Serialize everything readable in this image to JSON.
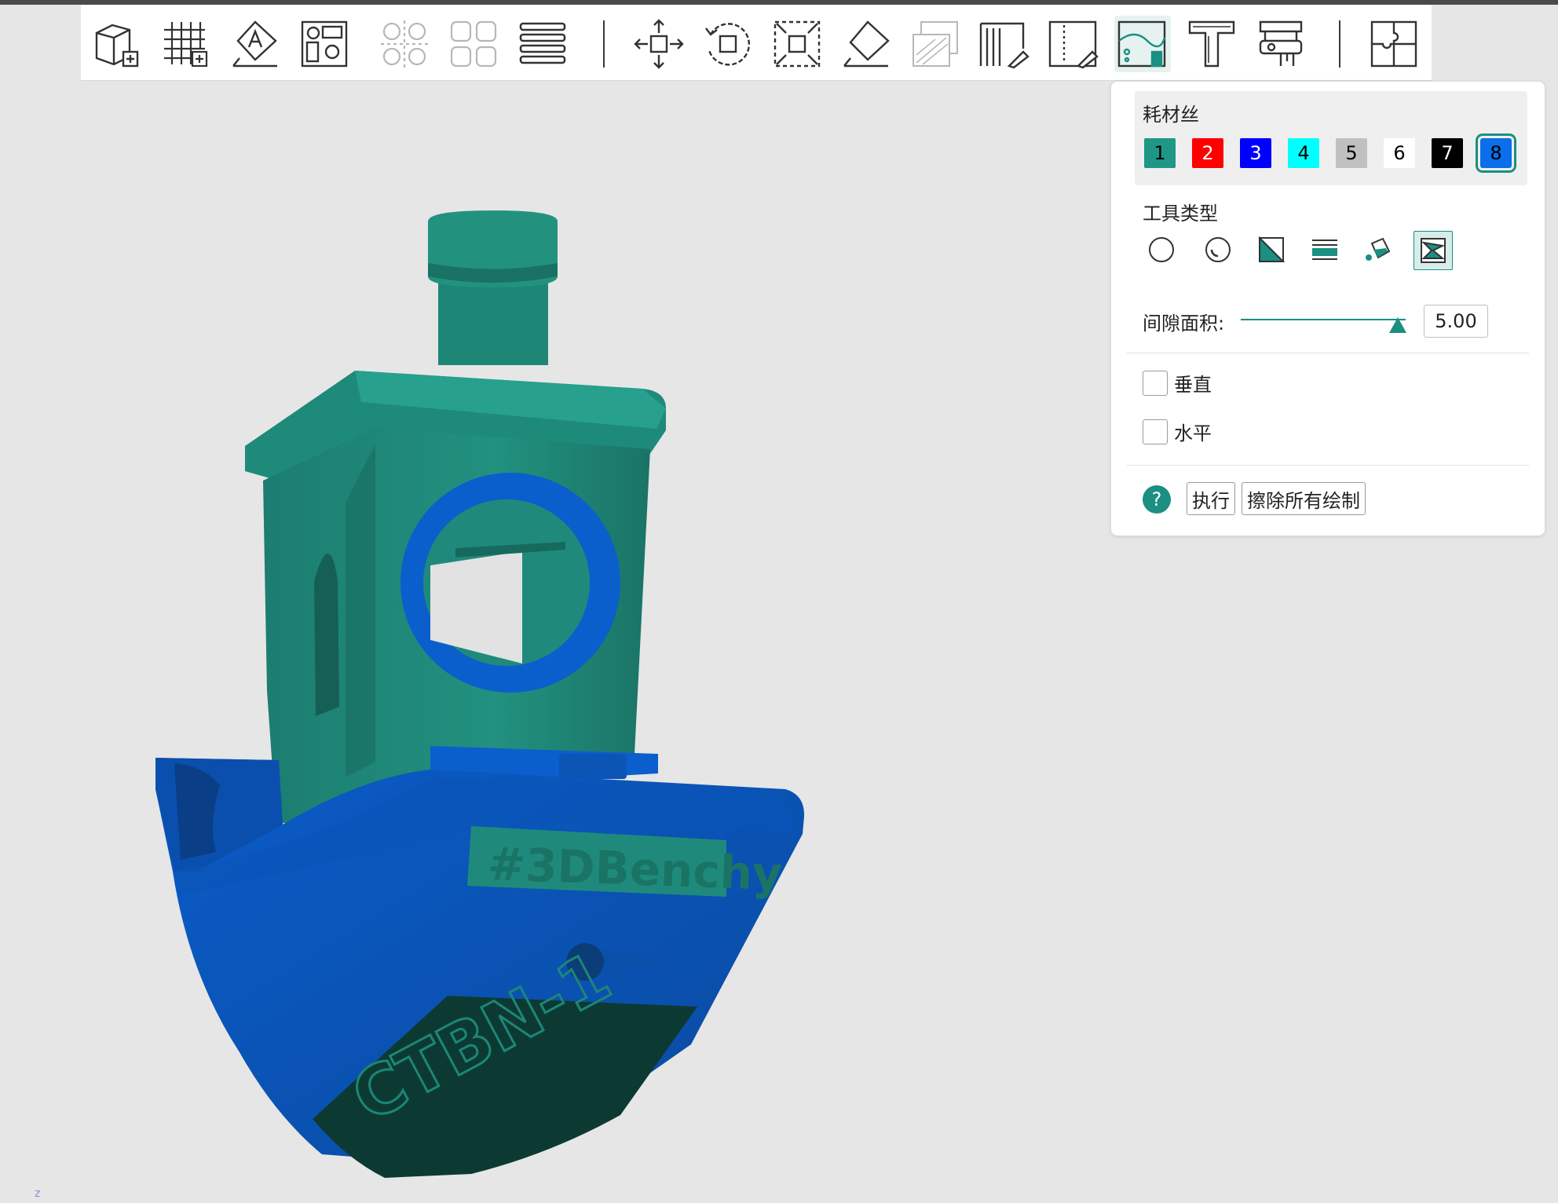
{
  "toolbar": {
    "tools": [
      {
        "name": "add-object",
        "icon": "cube-plus-icon",
        "state": "enabled"
      },
      {
        "name": "add-plate",
        "icon": "grid-plus-icon",
        "state": "enabled"
      },
      {
        "name": "auto-orient",
        "icon": "orient-a-icon",
        "state": "enabled"
      },
      {
        "name": "arrange",
        "icon": "arrange-icon",
        "state": "enabled"
      },
      {
        "name": "split-objects",
        "icon": "split-objects-icon",
        "state": "disabled"
      },
      {
        "name": "split-parts",
        "icon": "split-parts-icon",
        "state": "disabled"
      },
      {
        "name": "variable-layer-height",
        "icon": "layers-icon",
        "state": "enabled"
      },
      {
        "name": "move",
        "icon": "move-icon",
        "state": "enabled"
      },
      {
        "name": "rotate",
        "icon": "rotate-icon",
        "state": "enabled"
      },
      {
        "name": "scale",
        "icon": "scale-icon",
        "state": "enabled"
      },
      {
        "name": "lay-on-face",
        "icon": "lay-on-face-icon",
        "state": "enabled"
      },
      {
        "name": "cut",
        "icon": "cut-icon",
        "state": "disabled"
      },
      {
        "name": "support-paint",
        "icon": "support-paint-icon",
        "state": "enabled"
      },
      {
        "name": "seam-paint",
        "icon": "seam-paint-icon",
        "state": "enabled"
      },
      {
        "name": "color-paint",
        "icon": "color-paint-icon",
        "state": "active"
      },
      {
        "name": "text",
        "icon": "text-icon",
        "state": "enabled"
      },
      {
        "name": "measure",
        "icon": "measure-icon",
        "state": "enabled"
      },
      {
        "name": "assembly",
        "icon": "puzzle-icon",
        "state": "enabled"
      }
    ]
  },
  "panel": {
    "filament_title": "耗材丝",
    "filaments": [
      {
        "label": "1",
        "color": "#1f9787",
        "text": "#000000"
      },
      {
        "label": "2",
        "color": "#ff0000",
        "text": "#ffffff"
      },
      {
        "label": "3",
        "color": "#0000ff",
        "text": "#ffffff"
      },
      {
        "label": "4",
        "color": "#00ffff",
        "text": "#000000"
      },
      {
        "label": "5",
        "color": "#c0c0c0",
        "text": "#000000"
      },
      {
        "label": "6",
        "color": "#ffffff",
        "text": "#000000"
      },
      {
        "label": "7",
        "color": "#000000",
        "text": "#ffffff"
      },
      {
        "label": "8",
        "color": "#0b6eea",
        "text": "#000000"
      }
    ],
    "selected_filament": "8",
    "tool_type_title": "工具类型",
    "tool_types": [
      {
        "name": "circle",
        "icon": "circle-brush-icon"
      },
      {
        "name": "sphere",
        "icon": "sphere-brush-icon"
      },
      {
        "name": "triangle",
        "icon": "triangle-brush-icon"
      },
      {
        "name": "height-range",
        "icon": "height-range-icon"
      },
      {
        "name": "fill",
        "icon": "fill-bucket-icon"
      },
      {
        "name": "gap-fill",
        "icon": "gap-fill-icon"
      }
    ],
    "active_tool_type": "gap-fill",
    "gap_area_label": "间隙面积:",
    "gap_area_value": "5.00",
    "gap_area_level": 0.95,
    "vertical_label": "垂直",
    "vertical_checked": false,
    "horizontal_label": "水平",
    "horizontal_checked": false,
    "help_symbol": "?",
    "execute_label": "执行",
    "erase_all_label": "擦除所有绘制"
  },
  "model": {
    "hull_text": "#3DBenchy",
    "bottom_text": "CTBN-1",
    "colors": {
      "body": "#1f8a7b",
      "accent": "#0b5fcc",
      "bottom": "#0c3a33",
      "accent_dark": "#0a4ea8"
    }
  },
  "viewport": {
    "corner_mark": "z"
  }
}
